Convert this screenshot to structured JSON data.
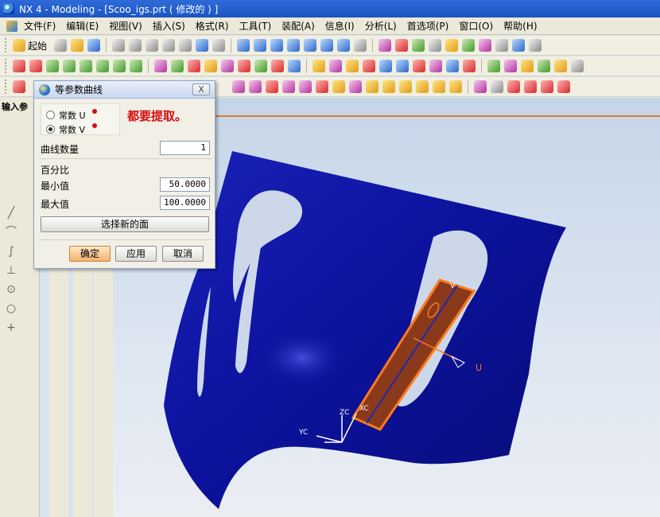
{
  "window": {
    "title": "NX 4 - Modeling - [Scoo_igs.prt ( 修改的 ) ]"
  },
  "menu": [
    "文件(F)",
    "编辑(E)",
    "视图(V)",
    "插入(S)",
    "格式(R)",
    "工具(T)",
    "装配(A)",
    "信息(I)",
    "分析(L)",
    "首选项(P)",
    "窗口(O)",
    "帮助(H)"
  ],
  "toolbar": {
    "start_label": "起始"
  },
  "left_panel": {
    "title": "输入参"
  },
  "dialog": {
    "title": "等参数曲线",
    "close_label": "X",
    "radio_u": "常数 U",
    "radio_v": "常数 V",
    "selected": "常数 V",
    "curve_count_label": "曲线数量",
    "curve_count_value": "1",
    "percent_label": "百分比",
    "min_label": "最小值",
    "min_value": "50.0000",
    "max_label": "最大值",
    "max_value": "100.0000",
    "select_face_button": "选择新的面",
    "ok_button": "确定",
    "apply_button": "应用",
    "cancel_button": "取消"
  },
  "annotation": {
    "text": "都要提取。",
    "color": "#d80c0c"
  },
  "viewport": {
    "axis_labels": {
      "zc": "ZC",
      "xc": "XC",
      "yc": "YC",
      "u": "U",
      "v": "V"
    },
    "colors": {
      "surface": "#0f16a0",
      "selection": "#e06a1c",
      "background": "#d6e2f0"
    }
  }
}
